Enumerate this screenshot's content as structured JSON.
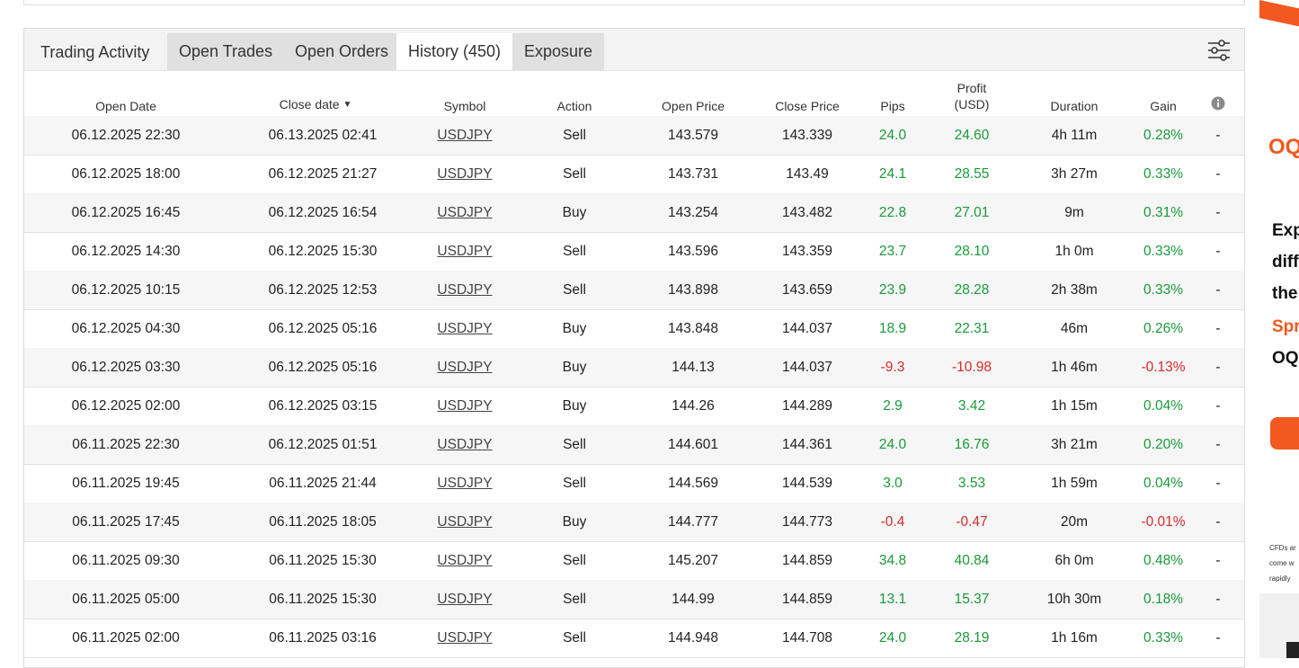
{
  "tabs": {
    "title": "Trading Activity",
    "items": [
      {
        "label": "Open Trades"
      },
      {
        "label": "Open Orders"
      },
      {
        "label": "History (450)"
      },
      {
        "label": "Exposure"
      }
    ],
    "active": "History (450)"
  },
  "columns": {
    "open_date": "Open Date",
    "close_date": "Close date",
    "sort_indicator": "▼",
    "symbol": "Symbol",
    "action": "Action",
    "open_price": "Open Price",
    "close_price": "Close Price",
    "pips": "Pips",
    "profit_line1": "Profit",
    "profit_line2": "(USD)",
    "duration": "Duration",
    "gain": "Gain"
  },
  "rows": [
    {
      "open": "06.12.2025 22:30",
      "close": "06.13.2025 02:41",
      "symbol": "USDJPY",
      "action": "Sell",
      "open_price": "143.579",
      "close_price": "143.339",
      "pips": "24.0",
      "profit": "24.60",
      "duration": "4h 11m",
      "gain": "0.28%",
      "extra": "-"
    },
    {
      "open": "06.12.2025 18:00",
      "close": "06.12.2025 21:27",
      "symbol": "USDJPY",
      "action": "Sell",
      "open_price": "143.731",
      "close_price": "143.49",
      "pips": "24.1",
      "profit": "28.55",
      "duration": "3h 27m",
      "gain": "0.33%",
      "extra": "-"
    },
    {
      "open": "06.12.2025 16:45",
      "close": "06.12.2025 16:54",
      "symbol": "USDJPY",
      "action": "Buy",
      "open_price": "143.254",
      "close_price": "143.482",
      "pips": "22.8",
      "profit": "27.01",
      "duration": "9m",
      "gain": "0.31%",
      "extra": "-"
    },
    {
      "open": "06.12.2025 14:30",
      "close": "06.12.2025 15:30",
      "symbol": "USDJPY",
      "action": "Sell",
      "open_price": "143.596",
      "close_price": "143.359",
      "pips": "23.7",
      "profit": "28.10",
      "duration": "1h 0m",
      "gain": "0.33%",
      "extra": "-"
    },
    {
      "open": "06.12.2025 10:15",
      "close": "06.12.2025 12:53",
      "symbol": "USDJPY",
      "action": "Sell",
      "open_price": "143.898",
      "close_price": "143.659",
      "pips": "23.9",
      "profit": "28.28",
      "duration": "2h 38m",
      "gain": "0.33%",
      "extra": "-"
    },
    {
      "open": "06.12.2025 04:30",
      "close": "06.12.2025 05:16",
      "symbol": "USDJPY",
      "action": "Buy",
      "open_price": "143.848",
      "close_price": "144.037",
      "pips": "18.9",
      "profit": "22.31",
      "duration": "46m",
      "gain": "0.26%",
      "extra": "-"
    },
    {
      "open": "06.12.2025 03:30",
      "close": "06.12.2025 05:16",
      "symbol": "USDJPY",
      "action": "Buy",
      "open_price": "144.13",
      "close_price": "144.037",
      "pips": "-9.3",
      "profit": "-10.98",
      "duration": "1h 46m",
      "gain": "-0.13%",
      "extra": "-"
    },
    {
      "open": "06.12.2025 02:00",
      "close": "06.12.2025 03:15",
      "symbol": "USDJPY",
      "action": "Buy",
      "open_price": "144.26",
      "close_price": "144.289",
      "pips": "2.9",
      "profit": "3.42",
      "duration": "1h 15m",
      "gain": "0.04%",
      "extra": "-"
    },
    {
      "open": "06.11.2025 22:30",
      "close": "06.12.2025 01:51",
      "symbol": "USDJPY",
      "action": "Sell",
      "open_price": "144.601",
      "close_price": "144.361",
      "pips": "24.0",
      "profit": "16.76",
      "duration": "3h 21m",
      "gain": "0.20%",
      "extra": "-"
    },
    {
      "open": "06.11.2025 19:45",
      "close": "06.11.2025 21:44",
      "symbol": "USDJPY",
      "action": "Sell",
      "open_price": "144.569",
      "close_price": "144.539",
      "pips": "3.0",
      "profit": "3.53",
      "duration": "1h 59m",
      "gain": "0.04%",
      "extra": "-"
    },
    {
      "open": "06.11.2025 17:45",
      "close": "06.11.2025 18:05",
      "symbol": "USDJPY",
      "action": "Buy",
      "open_price": "144.777",
      "close_price": "144.773",
      "pips": "-0.4",
      "profit": "-0.47",
      "duration": "20m",
      "gain": "-0.01%",
      "extra": "-"
    },
    {
      "open": "06.11.2025 09:30",
      "close": "06.11.2025 15:30",
      "symbol": "USDJPY",
      "action": "Sell",
      "open_price": "145.207",
      "close_price": "144.859",
      "pips": "34.8",
      "profit": "40.84",
      "duration": "6h 0m",
      "gain": "0.48%",
      "extra": "-"
    },
    {
      "open": "06.11.2025 05:00",
      "close": "06.11.2025 15:30",
      "symbol": "USDJPY",
      "action": "Sell",
      "open_price": "144.99",
      "close_price": "144.859",
      "pips": "13.1",
      "profit": "15.37",
      "duration": "10h 30m",
      "gain": "0.18%",
      "extra": "-"
    },
    {
      "open": "06.11.2025 02:00",
      "close": "06.11.2025 03:16",
      "symbol": "USDJPY",
      "action": "Sell",
      "open_price": "144.948",
      "close_price": "144.708",
      "pips": "24.0",
      "profit": "28.19",
      "duration": "1h 16m",
      "gain": "0.33%",
      "extra": "-"
    }
  ],
  "ad": {
    "logo": "OQ",
    "lines": [
      "Exp",
      "diff",
      "the",
      "Spr",
      "OQ"
    ],
    "fine": [
      "CFDs ar",
      "come w",
      "rapidly"
    ]
  },
  "colors": {
    "positive": "#1a9a3a",
    "negative": "#d62a2a",
    "accent": "#f2581f"
  },
  "icons": {
    "filter": "sliders-icon",
    "info": "info-icon"
  }
}
